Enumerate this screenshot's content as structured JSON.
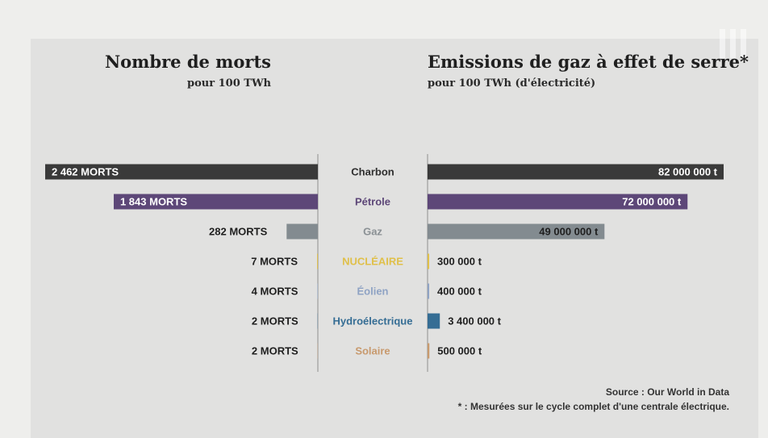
{
  "colors": {
    "background": "#eeeeec",
    "panel": "#e1e1e0",
    "divider": "#8e8e8e",
    "bar_label_dark": "#1f1f1f",
    "bar_label_light": "#ffffff"
  },
  "header": {
    "left_title": "Nombre de morts",
    "left_subtitle": "pour 100 TWh",
    "right_title": "Emissions de gaz à effet de serre*",
    "right_subtitle": "pour 100 TWh (d'électricité)"
  },
  "footer": {
    "source": "Source : Our World in Data",
    "note": "* : Mesurées sur le cycle complet d'une centrale électrique."
  },
  "chart_data": {
    "type": "bar",
    "layout": "butterfly",
    "categories": [
      "Charbon",
      "Pétrole",
      "Gaz",
      "NUCLÉAIRE",
      "Éolien",
      "Hydroélectrique",
      "Solaire"
    ],
    "category_colors": [
      "#2e2e2e",
      "#5d4778",
      "#8a9094",
      "#e0c04a",
      "#8fa3c4",
      "#356d94",
      "#c89a6e"
    ],
    "series": [
      {
        "name": "Nombre de morts",
        "values": [
          2462,
          1843,
          282,
          7,
          4,
          2,
          2
        ],
        "labels": [
          "2 462 MORTS",
          "1 843 MORTS",
          "282 MORTS",
          "7 MORTS",
          "4 MORTS",
          "2 MORTS",
          "2 MORTS"
        ],
        "bar_colors": [
          "#3a3a3a",
          "#5d4778",
          "#838b90",
          "#e0c04a",
          "#8fa3c4",
          "#356d94",
          "#c89a6e"
        ],
        "xlim": [
          0,
          2462
        ]
      },
      {
        "name": "Emissions de gaz à effet de serre",
        "values": [
          82000000,
          72000000,
          49000000,
          300000,
          400000,
          3400000,
          500000
        ],
        "labels": [
          "82 000 000 t",
          "72 000 000 t",
          "49 000 000 t",
          "300 000 t",
          "400 000 t",
          "3 400 000 t",
          "500 000 t"
        ],
        "bar_colors": [
          "#3a3a3a",
          "#5d4778",
          "#838b90",
          "#e0c04a",
          "#8fa3c4",
          "#356d94",
          "#c89a6e"
        ],
        "xlim": [
          0,
          82000000
        ]
      }
    ],
    "grid": false,
    "legend": "none"
  }
}
